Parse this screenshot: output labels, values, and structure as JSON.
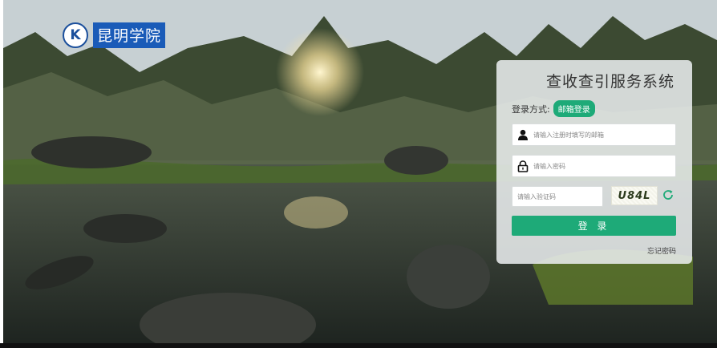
{
  "brand": {
    "emblem": "K",
    "name": "昆明学院"
  },
  "login_panel": {
    "title": "查收查引服务系统",
    "method_label": "登录方式:",
    "method_value": "邮箱登录",
    "email_placeholder": "请输入注册时填写的邮箱",
    "password_placeholder": "请输入密码",
    "captcha_placeholder": "请输入验证码",
    "captcha_text": "U84L",
    "login_label": "登 录",
    "forgot_label": "忘记密码"
  },
  "icons": {
    "user": "user-icon",
    "lock": "lock-icon",
    "refresh": "refresh-icon"
  },
  "colors": {
    "accent": "#1eaa78",
    "brand_blue": "#1a5bb8"
  }
}
